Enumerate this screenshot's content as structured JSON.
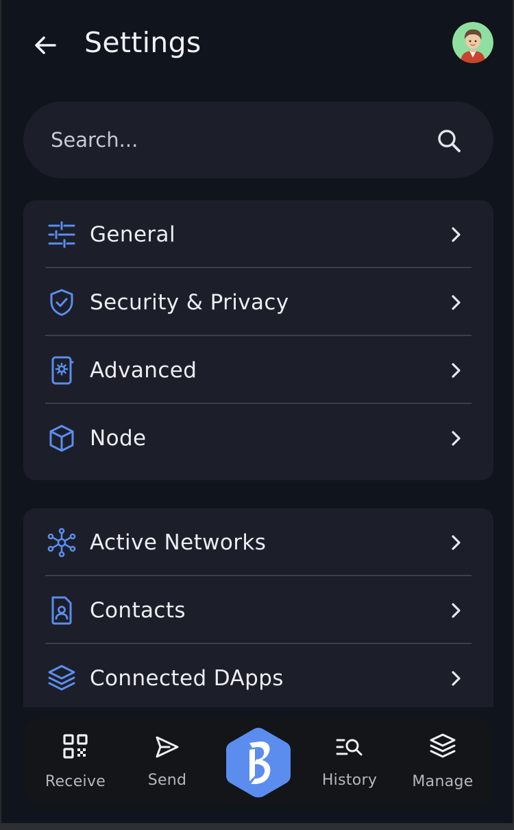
{
  "header": {
    "title": "Settings",
    "back_icon": "arrow-left-icon",
    "avatar_icon": "user-avatar"
  },
  "search": {
    "placeholder": "Search...",
    "value": "",
    "icon": "search-icon"
  },
  "groups": [
    {
      "items": [
        {
          "label": "General",
          "icon": "sliders-icon"
        },
        {
          "label": "Security & Privacy",
          "icon": "shield-check-icon"
        },
        {
          "label": "Advanced",
          "icon": "phone-gear-icon"
        },
        {
          "label": "Node",
          "icon": "cube-icon"
        }
      ]
    },
    {
      "items": [
        {
          "label": "Active Networks",
          "icon": "network-icon"
        },
        {
          "label": "Contacts",
          "icon": "contact-card-icon"
        },
        {
          "label": "Connected DApps",
          "icon": "layers-icon"
        }
      ]
    }
  ],
  "bottom_nav": {
    "items": [
      {
        "label": "Receive",
        "icon": "qr-code-icon"
      },
      {
        "label": "Send",
        "icon": "send-icon"
      },
      {
        "label": "History",
        "icon": "history-search-icon"
      },
      {
        "label": "Manage",
        "icon": "layers-icon"
      }
    ],
    "center": {
      "icon": "brand-logo-icon"
    }
  },
  "colors": {
    "background": "#10141d",
    "card": "#1c1f29",
    "accent": "#5b8def",
    "text": "#eceef4",
    "muted": "#b4b7c0"
  }
}
